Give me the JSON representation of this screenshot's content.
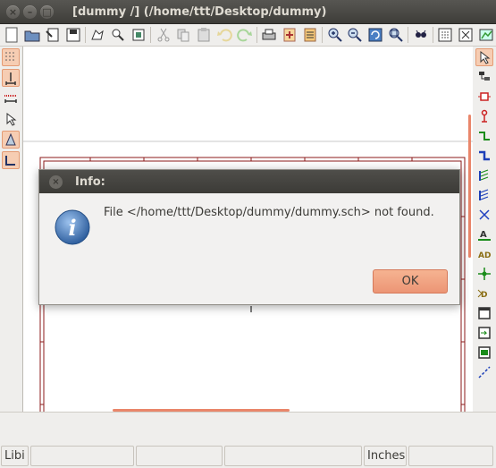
{
  "window": {
    "title": "[dummy /] (/home/ttt/Desktop/dummy)",
    "controls": {
      "close": "×",
      "minimize": "–",
      "maximize": "□"
    }
  },
  "toolbar": {
    "icons": [
      "new-schematic-icon",
      "open-file-icon",
      "sheet-setup-icon",
      "save-project-icon",
      "page-settings-icon",
      "find-icon",
      "undo-history-icon",
      "cut-icon",
      "copy-icon",
      "paste-icon",
      "undo-icon",
      "redo-icon",
      "print-icon",
      "plot-icon",
      "zoom-in-icon",
      "zoom-out-icon",
      "zoom-redraw-icon",
      "zoom-fit-icon",
      "navigate-hierarchy-icon",
      "annotate-icon",
      "erc-icon",
      "netlist-icon",
      "bom-icon"
    ]
  },
  "left_toolbar": {
    "icons": [
      "grid-icon",
      "units-inch-icon",
      "units-mm-icon",
      "cursor-shape-icon",
      "hidden-pins-icon",
      "horizontal-vertical-icon"
    ]
  },
  "right_toolbar": {
    "icons": [
      "select-arrow-icon",
      "hierarchy-navigator-icon",
      "add-component-icon",
      "add-power-icon",
      "add-wire-icon",
      "add-bus-icon",
      "wire-bus-entry-icon",
      "bus-bus-entry-icon",
      "no-connect-icon",
      "net-label-icon",
      "global-label-icon",
      "junction-icon",
      "hierarchical-label-icon",
      "hierarchical-sheet-icon",
      "import-sheet-pin-icon",
      "sheet-pin-icon",
      "graphic-lines-icon"
    ]
  },
  "dialog": {
    "title": "Info:",
    "message": "File </home/ttt/Desktop/dummy/dummy.sch> not found.",
    "ok_label": "OK",
    "close_glyph": "×",
    "icon_letter": "i"
  },
  "statusbar": {
    "field1": "Libi",
    "field2": "",
    "field3": "",
    "field4": "",
    "units": "Inches",
    "field6": ""
  },
  "colors": {
    "accent": "#e9866a",
    "sheet_border": "#8b1a1a",
    "dialog_title_bg": "#3c3b37"
  }
}
